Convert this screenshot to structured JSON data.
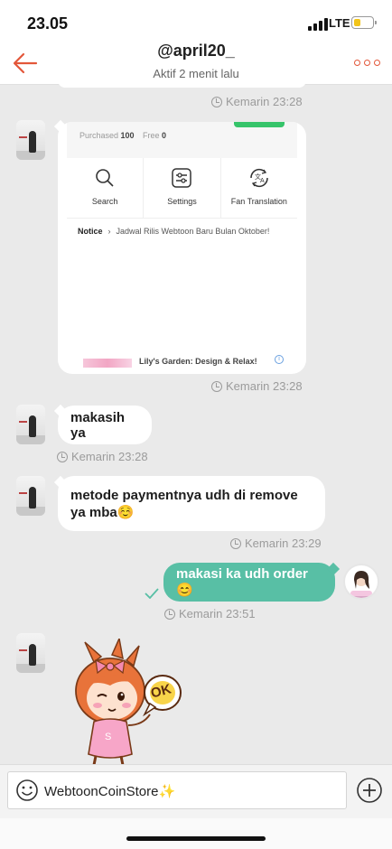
{
  "status_bar": {
    "time": "23.05",
    "network": "LTE",
    "battery_level": 0.35,
    "battery_color": "#f2c419"
  },
  "header": {
    "title": "@april20_",
    "subtitle": "Aktif 2 menit lalu",
    "back_icon": "arrow-left-icon",
    "more_icon": "more-dots-icon",
    "accent_color": "#e3573a"
  },
  "messages": [
    {
      "timestamp": "Kemarin 23:28"
    },
    {
      "type": "image",
      "screenshot": {
        "purchased_label": "Purchased",
        "purchased_value": "100",
        "free_label": "Free",
        "free_value": "0",
        "menu": [
          {
            "label": "Search",
            "icon": "search-icon"
          },
          {
            "label": "Settings",
            "icon": "settings-sliders-icon"
          },
          {
            "label": "Fan Translation",
            "icon": "fan-translation-icon"
          }
        ],
        "notice_label": "Notice",
        "notice_text": "Jadwal Rilis Webtoon Baru Bulan Oktober!",
        "ad_text": "Lily's Garden: Design & Relax!"
      },
      "timestamp": "Kemarin 23:28"
    },
    {
      "type": "text",
      "text": "makasih ya",
      "timestamp": "Kemarin 23:28"
    },
    {
      "type": "text",
      "text": "metode paymentnya udh di remove ya mba☺️",
      "timestamp": "Kemarin 23:29"
    },
    {
      "type": "text",
      "sender": "me",
      "text": "makasi ka udh order😊",
      "timestamp": "Kemarin 23:51",
      "status_icon": "check-icon"
    },
    {
      "type": "sticker",
      "sticker_text": "OK"
    }
  ],
  "input": {
    "value": "WebtoonCoinStore✨",
    "emoji_icon": "smiley-icon",
    "add_icon": "plus-circle-icon"
  },
  "colors": {
    "my_bubble": "#58bfa5",
    "background": "#eaeaea"
  }
}
